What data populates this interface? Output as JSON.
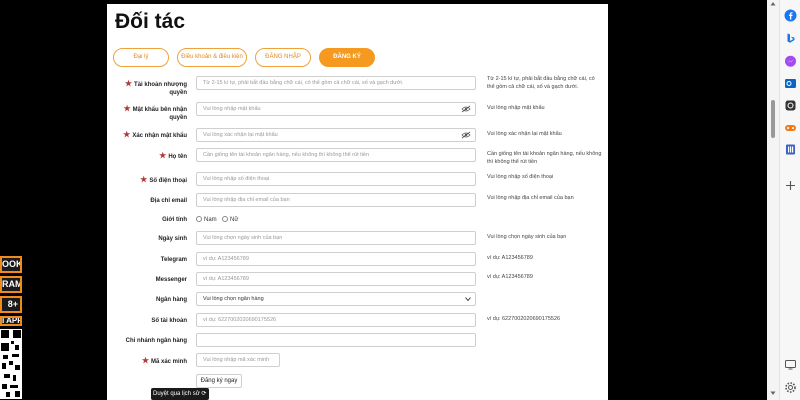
{
  "page": {
    "title": "Đối tác"
  },
  "tabs": [
    {
      "label": "Đại lý",
      "active": false
    },
    {
      "label": "Điều khoản & điều kiện",
      "active": false
    },
    {
      "label": "ĐĂNG NHẬP",
      "active": false
    },
    {
      "label": "ĐĂNG KÝ",
      "active": true
    }
  ],
  "form": {
    "username": {
      "label": "Tài khoản nhượng quyền",
      "placeholder": "Từ 2-15 kí tự, phải bắt đầu bằng chữ cái, có thể gồm cả chữ cái, số và gạch dưới.",
      "hint": "Từ 2-15 kí tự, phải bắt đầu bằng chữ cái, có thể gồm cả chữ cái, số và gạch dưới."
    },
    "password": {
      "label": "Mật khẩu bên nhận quyền",
      "placeholder": "Vui lòng nhập mật khẩu",
      "hint": "Vui lòng nhập mật khẩu"
    },
    "confirm_password": {
      "label": "Xác nhận mật khẩu",
      "placeholder": "Vui lòng xác nhận lại mật khẩu",
      "hint": "Vui lòng xác nhận lại mật khẩu"
    },
    "fullname": {
      "label": "Họ tên",
      "placeholder": "Cần giống tên tài khoản ngân hàng, nếu không thì không thể rút tiền",
      "hint": "Cần giống tên tài khoản ngân hàng, nếu không thì không thể rút tiền"
    },
    "phone": {
      "label": "Số điện thoại",
      "placeholder": "Vui lòng nhập số điện thoại",
      "hint": "Vui lòng nhập số điện thoại"
    },
    "email": {
      "label": "Địa chỉ email",
      "placeholder": "Vui lòng nhập địa chỉ email của bạn",
      "hint": "Vui lòng nhập địa chỉ email của bạn"
    },
    "gender": {
      "label": "Giới tính",
      "options": [
        "Nam",
        "Nữ"
      ]
    },
    "birthday": {
      "label": "Ngày sinh",
      "placeholder": "Vui lòng chọn ngày sinh của bạn",
      "hint": "Vui lòng chọn ngày sinh của bạn"
    },
    "telegram": {
      "label": "Telegram",
      "placeholder": "ví dụ:  A123456789",
      "hint": "ví dụ:   A123456789"
    },
    "messenger": {
      "label": "Messenger",
      "placeholder": "ví dụ:  A123456789",
      "hint": "ví dụ:   A123456789"
    },
    "bank": {
      "label": "Ngân hàng",
      "selected": "Vui lòng chọn ngân hàng"
    },
    "account_number": {
      "label": "Số tài khoản",
      "placeholder": "ví dụ:  6227002020690175526",
      "hint": "ví dụ:  6227002020690175526"
    },
    "branch": {
      "label": "Chi nhánh ngân hàng",
      "placeholder": ""
    },
    "captcha": {
      "label": "Mã xác minh",
      "placeholder": "Vui lòng nhập mã xác minh"
    },
    "submit_label": "Đăng ký ngay"
  },
  "promo": {
    "items": [
      "OOK",
      "RAM",
      "8+",
      "I APP"
    ]
  },
  "history_tab": "Duyệt qua lịch sử",
  "colors": {
    "accent": "#f59a1f",
    "required_star": "#b03a3a",
    "background": "#000000"
  },
  "sidepanel_icons": [
    "facebook-icon",
    "bing-icon",
    "messenger-icon",
    "outlook-icon",
    "copilot-icon",
    "calculator-icon",
    "games-icon",
    "office-icon",
    "add-icon",
    "screen-icon",
    "settings-icon"
  ]
}
